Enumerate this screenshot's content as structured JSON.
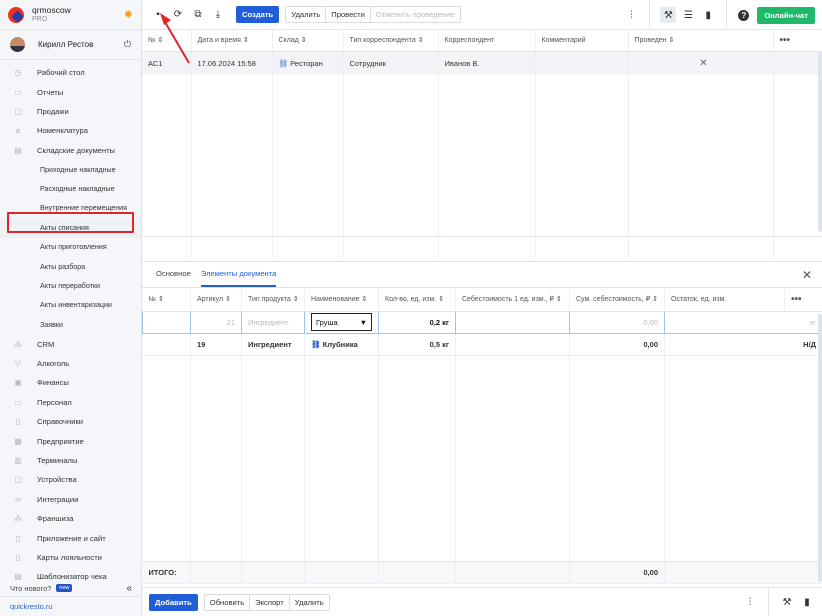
{
  "sidebar": {
    "org_name": "qrmoscow",
    "org_plan": "PRO",
    "user_name": "Кирилл Рестов",
    "items": [
      {
        "label": "Рабочий стол",
        "icon": "dashboard-icon"
      },
      {
        "label": "Отчеты",
        "icon": "reports-icon"
      },
      {
        "label": "Продажи",
        "icon": "sales-icon"
      },
      {
        "label": "Номенклатура",
        "icon": "nomenclature-icon"
      },
      {
        "label": "Складские документы",
        "icon": "warehouse-icon"
      }
    ],
    "sub_items": [
      "Приходные накладные",
      "Расходные накладные",
      "Внутренние перемещения",
      "Акты списания",
      "Акты приготовления",
      "Акты разбора",
      "Акты переработки",
      "Акты инвентаризации",
      "Заявки"
    ],
    "items2": [
      {
        "label": "CRM",
        "icon": "crm-icon"
      },
      {
        "label": "Алкоголь",
        "icon": "alcohol-icon"
      },
      {
        "label": "Финансы",
        "icon": "finance-icon"
      },
      {
        "label": "Персонал",
        "icon": "staff-icon"
      },
      {
        "label": "Справочники",
        "icon": "directory-icon"
      },
      {
        "label": "Предприятие",
        "icon": "enterprise-icon"
      },
      {
        "label": "Терминалы",
        "icon": "terminal-icon"
      },
      {
        "label": "Устройства",
        "icon": "devices-icon"
      },
      {
        "label": "Интеграции",
        "icon": "integrations-icon"
      },
      {
        "label": "Франшиза",
        "icon": "franchise-icon"
      },
      {
        "label": "Приложение и сайт",
        "icon": "app-icon"
      },
      {
        "label": "Карты лояльности",
        "icon": "loyalty-icon"
      },
      {
        "label": "Шаблонизатор чека",
        "icon": "receipt-icon"
      }
    ],
    "whats_new": "Что нового?",
    "new_badge": "new",
    "site": "quickresto.ru"
  },
  "toolbar": {
    "create": "Создать",
    "delete": "Удалить",
    "post": "Провести",
    "unpost": "Отменить проведение",
    "chat": "Онлайн-чат"
  },
  "docs_table": {
    "headers": [
      "№",
      "Дата и время",
      "Склад",
      "Тип корреспондента",
      "Корреспондент",
      "Комментарий",
      "Проведен"
    ],
    "row": {
      "num": "АС1",
      "date": "17.06.2024 15:58",
      "warehouse": "Ресторан",
      "corr_type": "Сотрудник",
      "corr": "Иванов В.",
      "comment": "",
      "posted": "✕"
    }
  },
  "tabs": {
    "main": "Основное",
    "items": "Элементы документа"
  },
  "items_table": {
    "headers": [
      "№",
      "Артикул",
      "Тип продукта",
      "Наименование",
      "Кол-во, ед. изм.",
      "Себестоимость 1 ед. изм., ₽",
      "Сум. себестоимость, ₽",
      "Остаток, ед. изм."
    ],
    "edit_row": {
      "article": "21",
      "type": "Ингредиент",
      "name": "Груша",
      "qty": "0,2 кг",
      "cost": "",
      "sum": "0,00",
      "rest": "кг"
    },
    "row": {
      "article": "19",
      "type": "Ингредиент",
      "name": "Клубника",
      "qty": "0,5 кг",
      "cost": "",
      "sum": "0,00",
      "rest": "Н/Д"
    },
    "total_label": "ИТОГО:",
    "total_sum": "0,00"
  },
  "footer": {
    "add": "Добавить",
    "refresh": "Обновить",
    "export": "Экспорт",
    "delete": "Удалить"
  }
}
